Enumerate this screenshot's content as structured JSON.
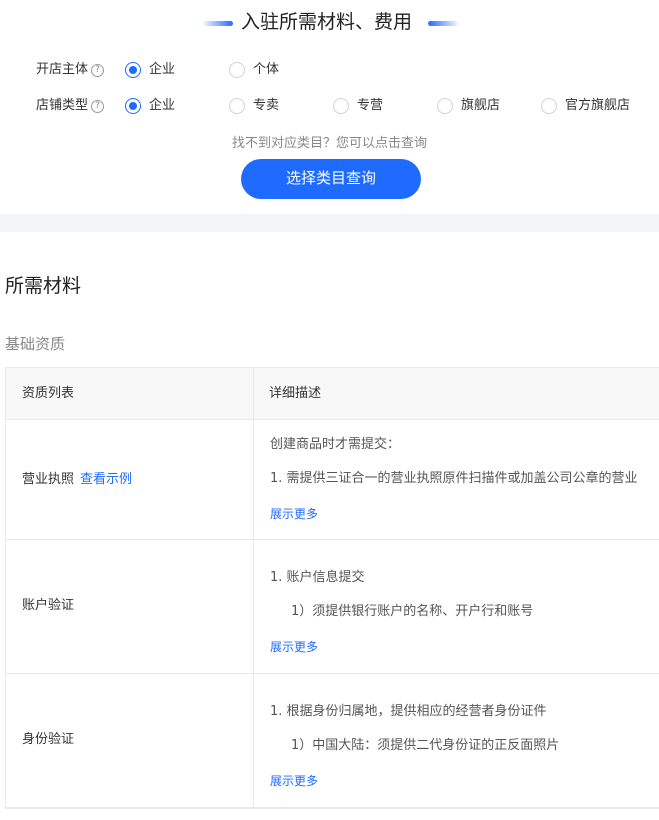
{
  "header": {
    "title": "入驻所需材料、费用"
  },
  "options": {
    "subject": {
      "label": "开店主体",
      "help": "?",
      "choices": [
        "企业",
        "个体"
      ],
      "selected": "企业"
    },
    "store_type": {
      "label": "店铺类型",
      "help": "?",
      "choices": [
        "企业",
        "专卖",
        "专营",
        "旗舰店",
        "官方旗舰店"
      ],
      "selected": "企业"
    }
  },
  "hint": "找不到对应类目？您可以点击查询",
  "query_button": "选择类目查询",
  "section_title": "所需材料",
  "sub_title": "基础资质",
  "table": {
    "headers": [
      "资质列表",
      "详细描述"
    ],
    "rows": [
      {
        "name": "营业执照",
        "link": "查看示例",
        "lines": [
          "创建商品时才需提交：",
          "1.  需提供三证合一的营业执照原件扫描件或加盖公司公章的营业"
        ],
        "more": "展示更多"
      },
      {
        "name": "账户验证",
        "lines": [
          "1.  账户信息提交",
          "1）须提供银行账户的名称、开户行和账号"
        ],
        "more": "展示更多"
      },
      {
        "name": "身份验证",
        "lines": [
          "1.  根据身份归属地，提供相应的经营者身份证件",
          "1）中国大陆：须提供二代身份证的正反面照片"
        ],
        "more": "展示更多"
      }
    ]
  },
  "colors": {
    "accent": "#1f6bff",
    "band": "#f4f5f7"
  },
  "icons": [
    "help-circle-icon",
    "radio-icon"
  ]
}
